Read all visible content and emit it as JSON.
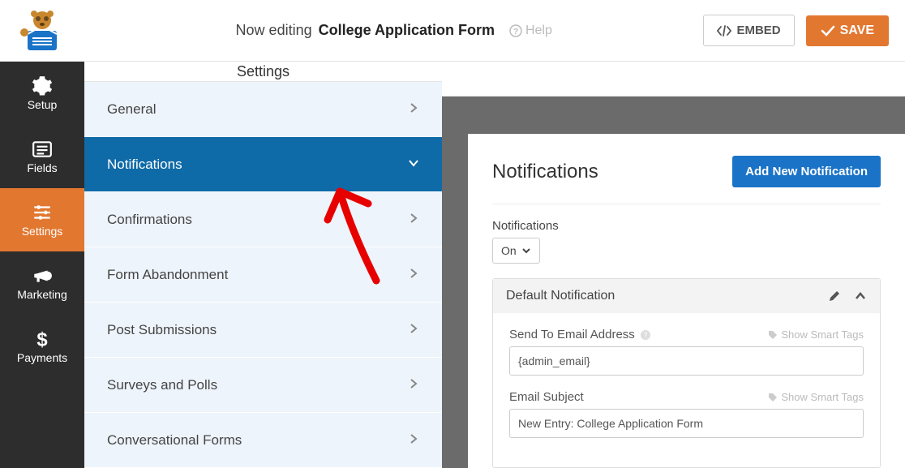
{
  "header": {
    "editing_prefix": "Now editing",
    "form_name": "College Application Form",
    "help": "Help",
    "embed": "EMBED",
    "save": "SAVE"
  },
  "sidenav": {
    "items": [
      {
        "label": "Setup"
      },
      {
        "label": "Fields"
      },
      {
        "label": "Settings"
      },
      {
        "label": "Marketing"
      },
      {
        "label": "Payments"
      }
    ]
  },
  "settings": {
    "title": "Settings",
    "rows": [
      {
        "label": "General"
      },
      {
        "label": "Notifications"
      },
      {
        "label": "Confirmations"
      },
      {
        "label": "Form Abandonment"
      },
      {
        "label": "Post Submissions"
      },
      {
        "label": "Surveys and Polls"
      },
      {
        "label": "Conversational Forms"
      }
    ]
  },
  "content": {
    "title": "Notifications",
    "add_button": "Add New Notification",
    "toggle_label": "Notifications",
    "toggle_value": "On",
    "default_block": {
      "title": "Default Notification",
      "send_to_label": "Send To Email Address",
      "send_to_value": "{admin_email}",
      "subject_label": "Email Subject",
      "subject_value": "New Entry: College Application Form",
      "smart_tags": "Show Smart Tags"
    }
  }
}
